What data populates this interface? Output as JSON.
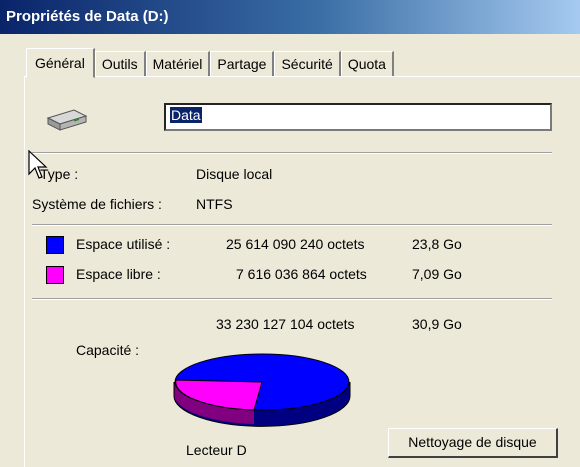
{
  "window": {
    "title": "Propriétés de Data (D:)"
  },
  "tabs": [
    {
      "label": "Général",
      "active": true
    },
    {
      "label": "Outils"
    },
    {
      "label": "Matériel"
    },
    {
      "label": "Partage"
    },
    {
      "label": "Sécurité"
    },
    {
      "label": "Quota"
    }
  ],
  "drive": {
    "name": "Data",
    "icon": "hard-drive-icon"
  },
  "info": {
    "type_label": "Type :",
    "type_value": "Disque local",
    "fs_label": "Système de fichiers :",
    "fs_value": "NTFS"
  },
  "used": {
    "label": "Espace utilisé :",
    "bytes": "25 614 090 240 octets",
    "size": "23,8 Go",
    "color": "#0000ff"
  },
  "free": {
    "label": "Espace libre :",
    "bytes": "7 616 036 864 octets",
    "size": "7,09 Go",
    "color": "#ff00ff"
  },
  "capacity": {
    "label": "Capacité :",
    "bytes": "33 230 127 104 octets",
    "size": "30,9 Go"
  },
  "chart": {
    "used_fraction": 0.771,
    "free_fraction": 0.229,
    "drive_label": "Lecteur D"
  },
  "buttons": {
    "cleanup": "Nettoyage de disque"
  }
}
